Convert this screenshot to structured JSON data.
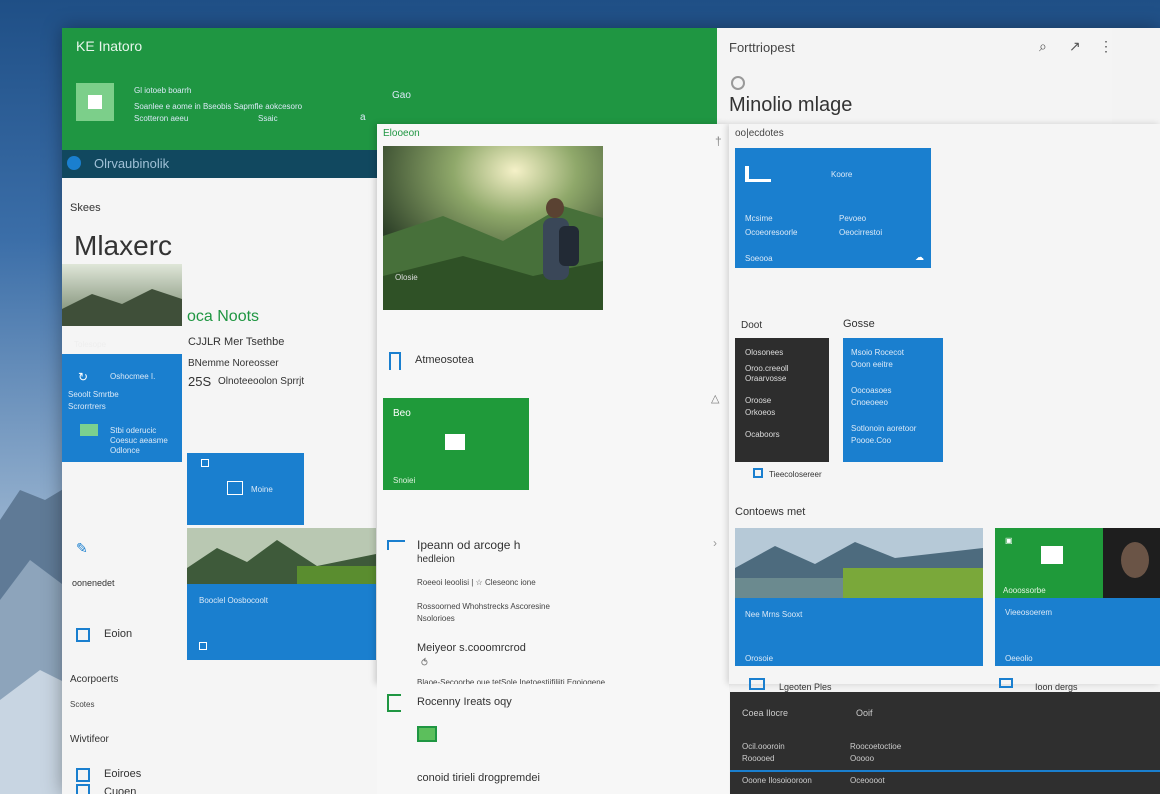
{
  "header": {
    "app_title": "KE Inatoro",
    "tile_line1": "Gl iotoeb boarrh",
    "tile_line2": "Soanlee e aome in Bseobis Sapmfle aokcesoro",
    "tile_line3": "Scotteron aeeu",
    "tile_line4": "Ssaic",
    "side_text": "Gao",
    "side_arrow": "a"
  },
  "right_header": {
    "title": "Forttriopest",
    "heading": "Minolio mlage",
    "sub_label": "oo|ecdotes"
  },
  "sidebar": {
    "bar_label": "Olrvaubinolik",
    "section_label": "Skees",
    "big_title": "Mlaxerc",
    "photo_caption": "Tolesope",
    "blue_tile_title": "Oshocmee I.",
    "blue_tile_l1": "Seoolt Smrtbe",
    "blue_tile_l2": "Scrorrtrers",
    "blue_tile_l3": "Stbi oderucic",
    "blue_tile_l4": "Coesuc aeasme",
    "blue_tile_l5": "Odlonce",
    "item1": "oonenedet",
    "item2": "Eoion",
    "item3": "Acorpoerts",
    "item3_sub": "Scotes",
    "item4": "Wivtifeor",
    "item5": "Eoiroes",
    "item6": "Cuoen"
  },
  "middle_col": {
    "green_title": "oca Noots",
    "line1": "CJJLR Mer Tsethbe",
    "line2": "BNemme Noreosser",
    "line3_num": "25S",
    "line3_text": "Olnoteeoolon Sprrjt",
    "blue_tile_label": "Moine",
    "photo_tile_caption": "Booclel Oosbocoolt"
  },
  "center": {
    "panel_label": "Elooeon",
    "photo_caption": "Olosie",
    "row1_label": "Atmeosotea",
    "green_tile_title": "Beo",
    "green_tile_caption": "Snoiei",
    "section_title": "Ipeann od arcoge h",
    "section_sub": "hedleion",
    "sec_line1": "Roeeoi leoolisi | ☆ Cleseonc ione",
    "sec_line2": "Rossoorned Whohstrecks Ascoresine",
    "sec_line3": "Nsolorioes",
    "sub_title": "Meiyeor s.cooomrcrod",
    "footer": "Blaoe-Secoorbe oue tetSole Inetoestiifiliiti Egoiogene",
    "bottom1": "Rocenny Ireats oqy",
    "bottom2": "conoid tirieli drogpremdei"
  },
  "right_panel": {
    "blue_tile_head": "Koore",
    "blue_l1": "Mcsime",
    "blue_l2": "Ocoeoresoorle",
    "blue_l3": "Pevoeo",
    "blue_l4": "Oeocirrestoi",
    "blue_l5": "Soeooa",
    "label_doot": "Doot",
    "label_oosse": "Gosse",
    "dark_l1": "Olosonees",
    "dark_l2": "Oroo.creeoll",
    "dark_l3": "Oraarvosse",
    "dark_l4": "Oroose",
    "dark_l5": "Orkoeos",
    "dark_l6": "Ocaboors",
    "blue2_l1": "Msoio Rocecot",
    "blue2_l2": "Ooon eeitre",
    "blue2_l3": "Oocoasoes",
    "blue2_l4": "Cnoeoeeo",
    "blue2_l5": "Sotlonoin aoretoor",
    "blue2_l6": "Poooe.Coo",
    "under_tile": "Tieecolosereer",
    "section_title": "Contoews met",
    "photo_tile_caption": "Nee Mrns Sooxt",
    "photo_tile_sub": "Orosoie",
    "green_caption": "Aooossorbe",
    "green_sub2": "Vieeosoerem",
    "green_sub3": "Oeeolio",
    "foot_left": "Lgeoten Ples",
    "foot_right": "Ioon dergs"
  },
  "bottom_dark": {
    "l1": "Coea Ilocre",
    "l2": "Ooif",
    "l3": "Ocil.oooroin",
    "l4": "Rooooed",
    "l5": "Roocoetoctioe",
    "l6": "Ooooo",
    "l7": "Ooone Ilosoiooroon",
    "l8": "Oceoooot"
  },
  "colors": {
    "green": "#1f9642",
    "blue": "#1a7fcf",
    "dark": "#2d2d2d"
  }
}
